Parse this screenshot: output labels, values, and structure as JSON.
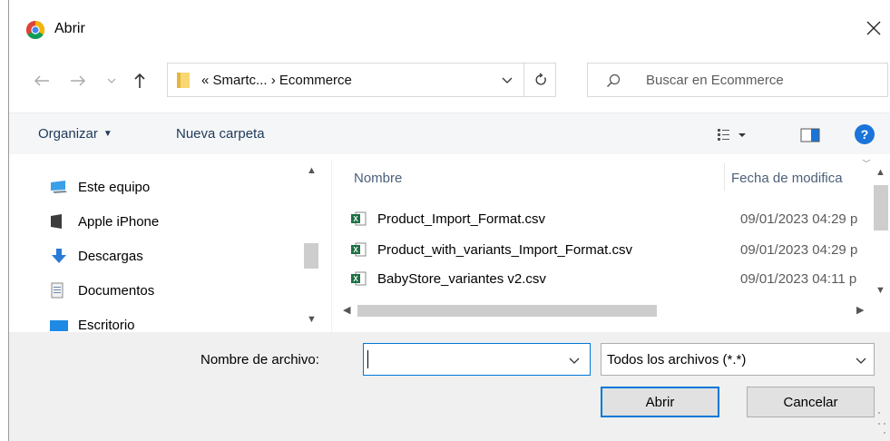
{
  "window": {
    "title": "Abrir",
    "app_icon": "chrome-icon",
    "close_icon": "close-icon"
  },
  "address": {
    "path_prefix": "«",
    "path_parent": "Smartc...",
    "path_separator": "›",
    "path_current": "Ecommerce"
  },
  "search": {
    "placeholder": "Buscar en Ecommerce"
  },
  "toolbar": {
    "organize_label": "Organizar",
    "new_folder_label": "Nueva carpeta",
    "help_label": "?"
  },
  "navigation": {
    "items": [
      {
        "label": "Este equipo",
        "icon": "computer-icon"
      },
      {
        "label": "Apple iPhone",
        "icon": "phone-icon"
      },
      {
        "label": "Descargas",
        "icon": "download-icon"
      },
      {
        "label": "Documentos",
        "icon": "document-icon"
      },
      {
        "label": "Escritorio",
        "icon": "desktop-icon"
      }
    ]
  },
  "files": {
    "columns": {
      "name": "Nombre",
      "date": "Fecha de modifica"
    },
    "rows": [
      {
        "name": "Product_Import_Format.csv",
        "date": "09/01/2023 04:29 p",
        "icon": "excel-csv-icon"
      },
      {
        "name": "Product_with_variants_Import_Format.csv",
        "date": "09/01/2023 04:29 p",
        "icon": "excel-csv-icon"
      },
      {
        "name": "BabyStore_variantes v2.csv",
        "date": "09/01/2023 04:11 p",
        "icon": "excel-csv-icon"
      }
    ]
  },
  "footer": {
    "filename_label": "Nombre de archivo:",
    "filename_value": "",
    "filetype_value": "Todos los archivos (*.*)",
    "open_button": "Abrir",
    "cancel_button": "Cancelar"
  },
  "colors": {
    "accent": "#0078d7",
    "toolbar_bg": "#f5f6f7",
    "footer_bg": "#f0f0f0",
    "link_text": "#1e3959"
  }
}
